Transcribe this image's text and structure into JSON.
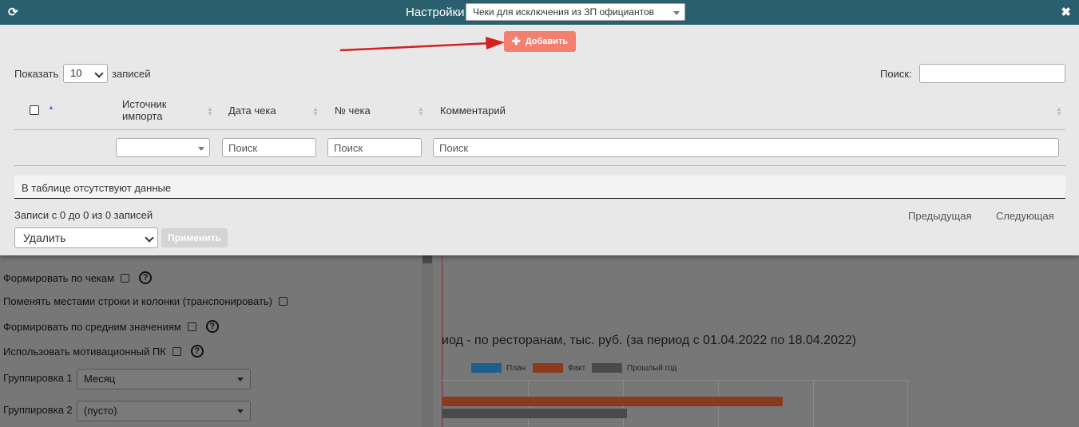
{
  "modal": {
    "title": "Настройки",
    "settings_select_value": "Чеки для исключения из ЗП официантов",
    "add_label": "Добавить",
    "show_label": "Показать",
    "page_size_value": "10",
    "records_label": "записей",
    "search_label": "Поиск:",
    "table": {
      "headers": [
        "Источник импорта",
        "Дата чека",
        "№ чека",
        "Комментарий"
      ],
      "filter_placeholders": [
        "Поиск",
        "Поиск",
        "Поиск"
      ],
      "empty_text": "В таблице отсутствуют данные"
    },
    "info_text": "Записи с 0 до 0 из 0 записей",
    "prev_label": "Предыдущая",
    "next_label": "Следующая",
    "bulk_action_value": "Удалить",
    "apply_label": "Применить"
  },
  "background": {
    "options": [
      {
        "label": "Формировать по чекам",
        "help": true
      },
      {
        "label": "Поменять местами строки и колонки (транспонировать)",
        "help": false
      },
      {
        "label": "Формировать по средним значениям",
        "help": true
      },
      {
        "label": "Использовать мотивационный ПК",
        "help": true
      }
    ],
    "group1_label": "Группировка 1",
    "group1_value": "Месяц",
    "group2_label": "Группировка 2",
    "group2_value": "(пусто)",
    "chart_title": "иод - по ресторанам, тыс. руб. (за период с 01.04.2022 по 18.04.2022)",
    "legend": [
      {
        "name": "План",
        "color": "#1f77b4"
      },
      {
        "name": "Факт",
        "color": "#d9522a"
      },
      {
        "name": "Прошлый год",
        "color": "#5a5a5a"
      }
    ]
  },
  "colors": {
    "header_bg": "#2a5f6e",
    "add_button": "#f27f6f",
    "arrow": "#d42020"
  }
}
